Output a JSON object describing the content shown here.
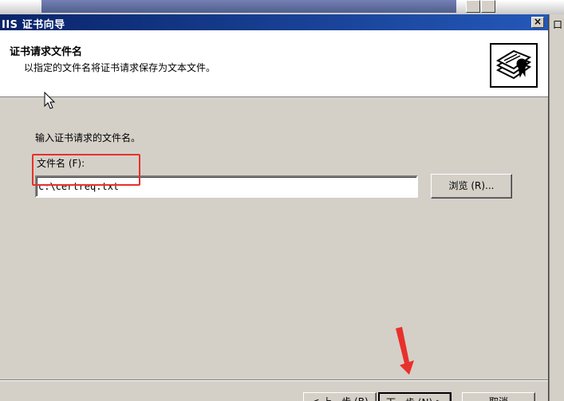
{
  "dialog": {
    "title": "IIS 证书向导",
    "close_label": "×",
    "header": {
      "title": "证书请求文件名",
      "subtitle": "以指定的文件名将证书请求保存为文本文件。"
    },
    "instruction": "输入证书请求的文件名。",
    "filename": {
      "label": "文件名 (F):",
      "value": "c:\\certreq.txt"
    },
    "buttons": {
      "browse": "浏览 (R)...",
      "back": "< 上一步 (B)",
      "next": "下一步 (N) >",
      "cancel": "取消"
    }
  },
  "background": {
    "right_fragment": "口"
  },
  "colors": {
    "titlebar_start": "#0a246a",
    "titlebar_end": "#2458b8",
    "dialog_face": "#d4d0c8",
    "annotation_red": "#e8302c"
  },
  "icons": {
    "wizard": "certificate-wizard-icon",
    "cursor": "mouse-pointer-icon",
    "annotation": "red-arrow-icon"
  }
}
